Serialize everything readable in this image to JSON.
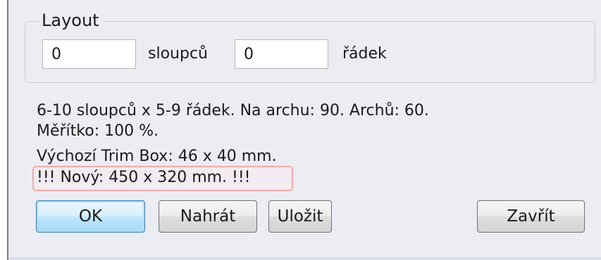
{
  "layout_group": {
    "title": "Layout",
    "columns_value": "0",
    "columns_label": "sloupců",
    "rows_value": "0",
    "rows_label": "řádek"
  },
  "info": {
    "line1": "6-10 sloupců x 5-9 řádek. Na archu: 90. Archů: 60.",
    "line2": "Měřítko: 100 %.",
    "line3": "Výchozí Trim Box: 46 x 40 mm.",
    "warning": "!!! Nový: 450 x 320 mm. !!!"
  },
  "buttons": {
    "ok": "OK",
    "load": "Nahrát",
    "save": "Uložit",
    "close": "Zavřít"
  },
  "colors": {
    "panel_background": "#ebedf3",
    "warning_highlight": "#f2a9a9",
    "default_button_border": "#3c7fb1"
  }
}
